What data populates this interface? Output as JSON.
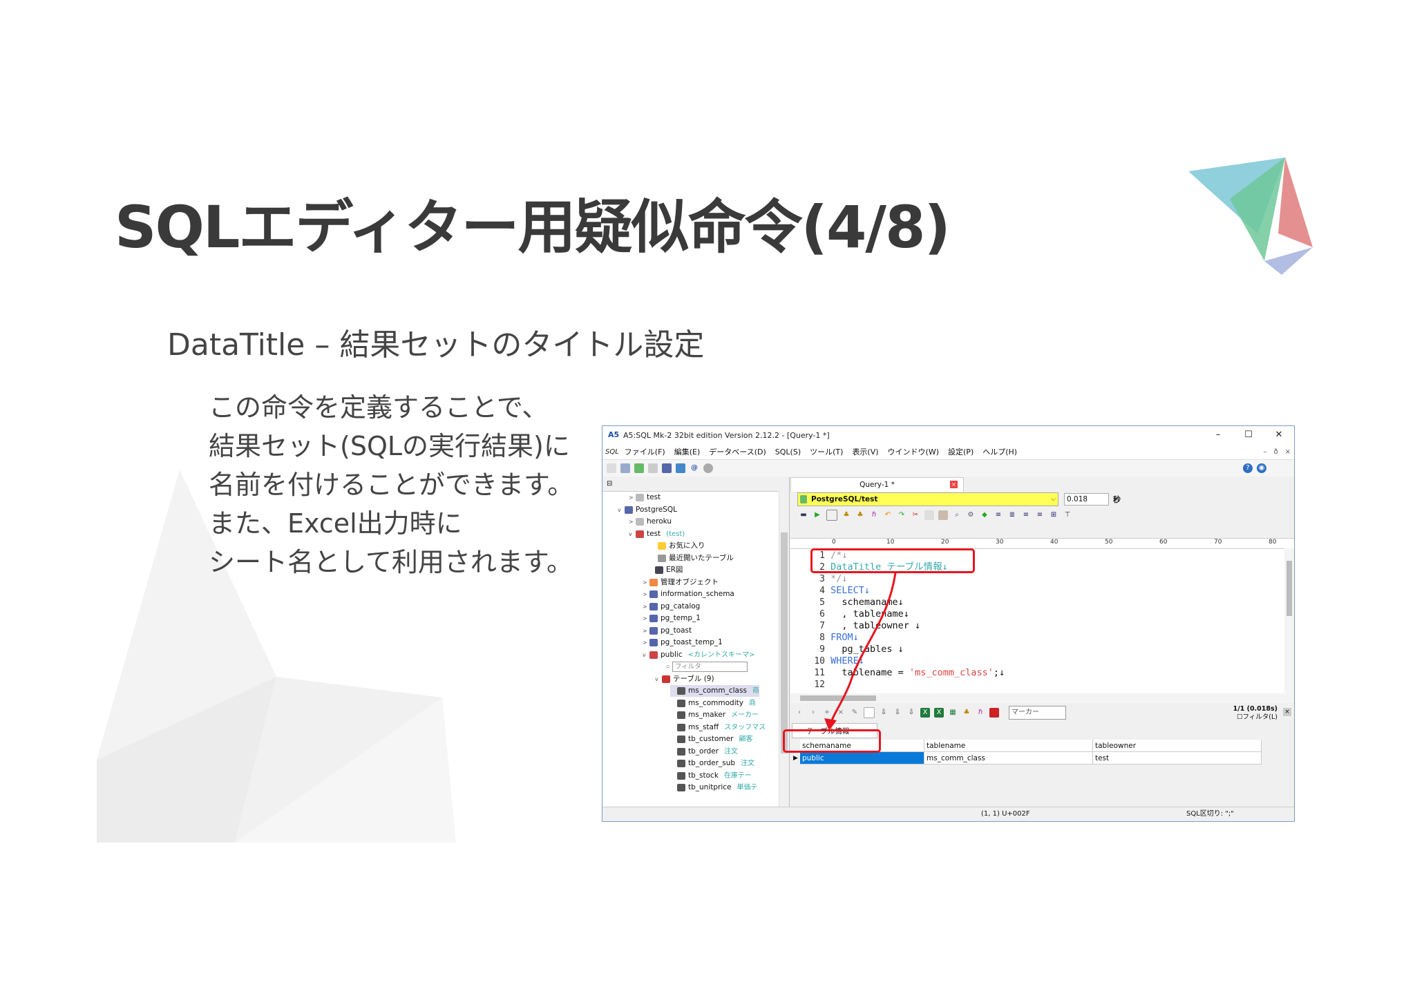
{
  "slide": {
    "title": "SQLエディター用疑似命令(4/8)",
    "subtitle": "DataTitle – 結果セットのタイトル設定",
    "body": [
      "この命令を定義することで、",
      "結果セット(SQLの実行結果)に",
      "名前を付けることができます。",
      "また、Excel出力時に",
      "シート名として利用されます。"
    ],
    "logo_colors": [
      "#7cc7d6",
      "#6dc89a",
      "#e07d7d",
      "#aab6e0"
    ]
  },
  "app": {
    "window_title": "A5:SQL Mk-2 32bit edition Version 2.12.2 - [Query-1 *]",
    "window_buttons": [
      "–",
      "☐",
      "✕"
    ],
    "menu_badge": "SQL",
    "menu": [
      "ファイル(F)",
      "編集(E)",
      "データベース(D)",
      "SQL(S)",
      "ツール(T)",
      "表示(V)",
      "ウインドウ(W)",
      "設定(P)",
      "ヘルプ(H)"
    ],
    "mdi_buttons": [
      "–",
      "ð",
      "×"
    ],
    "tree": [
      {
        "label": "test",
        "arrow": ">"
      },
      {
        "label": "PostgreSQL",
        "arrow": "v"
      },
      {
        "label": "heroku",
        "arrow": ">"
      },
      {
        "label": "test",
        "arrow": "v",
        "note": "(test)"
      },
      {
        "label": "お気に入り",
        "arrow": ""
      },
      {
        "label": "最近開いたテーブル",
        "arrow": ""
      },
      {
        "label": "ER図",
        "arrow": ""
      },
      {
        "label": "管理オブジェクト",
        "arrow": ">"
      },
      {
        "label": "information_schema",
        "arrow": ">"
      },
      {
        "label": "pg_catalog",
        "arrow": ">"
      },
      {
        "label": "pg_temp_1",
        "arrow": ">"
      },
      {
        "label": "pg_toast",
        "arrow": ">"
      },
      {
        "label": "pg_toast_temp_1",
        "arrow": ">"
      },
      {
        "label": "public",
        "arrow": "v",
        "note": "<カレントスキーマ>"
      },
      {
        "label": "フィルタ",
        "arrow": ""
      },
      {
        "label": "テーブル (9)",
        "arrow": "v"
      },
      {
        "label": "ms_comm_class",
        "arrow": "",
        "note": "商"
      },
      {
        "label": "ms_commodity",
        "arrow": "",
        "note": "商"
      },
      {
        "label": "ms_maker",
        "arrow": "",
        "note": "メーカー"
      },
      {
        "label": "ms_staff",
        "arrow": "",
        "note": "スタッフマス"
      },
      {
        "label": "tb_customer",
        "arrow": "",
        "note": "顧客"
      },
      {
        "label": "tb_order",
        "arrow": "",
        "note": "注文"
      },
      {
        "label": "tb_order_sub",
        "arrow": "",
        "note": "注文"
      },
      {
        "label": "tb_stock",
        "arrow": "",
        "note": "在庫テー"
      },
      {
        "label": "tb_unitprice",
        "arrow": "",
        "note": "単価テ"
      }
    ],
    "query_tab": "Query-1 *",
    "connection": "PostgreSQL/test",
    "elapsed": "0.018",
    "elapsed_unit": "秒",
    "ruler": [
      "0",
      "10",
      "20",
      "30",
      "40",
      "50",
      "60",
      "70",
      "80"
    ],
    "code": [
      {
        "n": "1",
        "text": "/*↓"
      },
      {
        "n": "2",
        "text": "DataTitle テーブル情報↓"
      },
      {
        "n": "3",
        "text": "*/↓"
      },
      {
        "n": "4",
        "text": "SELECT↓"
      },
      {
        "n": "5",
        "text": "  schemaname↓"
      },
      {
        "n": "6",
        "text": "  , tablename↓"
      },
      {
        "n": "7",
        "text": "  , tableowner ↓"
      },
      {
        "n": "8",
        "text": "FROM↓"
      },
      {
        "n": "9",
        "text": "  pg_tables ↓"
      },
      {
        "n": "10",
        "text": "WHERE↓"
      },
      {
        "n": "11",
        "text": "  tablename = 'ms_comm_class';↓"
      },
      {
        "n": "12",
        "text": ""
      }
    ],
    "marker_placeholder": "マーカー",
    "result_count": "1/1 (0.018s)",
    "result_filter": "☐フィルタ(L)",
    "result_tab": "テーブル情報",
    "grid": {
      "columns": [
        "schemaname",
        "tablename",
        "tableowner"
      ],
      "rows": [
        [
          "public",
          "ms_comm_class",
          "test"
        ]
      ]
    },
    "status": {
      "position": "(1, 1) U+002F",
      "separator": "SQL区切り: \";\""
    }
  },
  "colors": {
    "highlight": "#e8141e",
    "selection": "#0a7ad9",
    "connection_bg": "#ffff55"
  }
}
